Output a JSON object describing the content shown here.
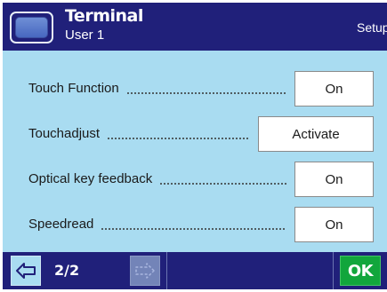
{
  "header": {
    "title": "Terminal",
    "user": "User 1",
    "setup": "Setup",
    "icon": "terminal-icon"
  },
  "rows": [
    {
      "label": "Touch Function",
      "value": "On"
    },
    {
      "label": "Touchadjust",
      "value": "Activate"
    },
    {
      "label": "Optical key feedback",
      "value": "On"
    },
    {
      "label": "Speedread",
      "value": "On"
    }
  ],
  "footer": {
    "page": "2/2",
    "back_icon": "arrow-left-icon",
    "forward_icon": "arrow-right-disabled-icon",
    "ok_label": "OK"
  },
  "colors": {
    "background": "#a9dcf1",
    "bar": "#20207a",
    "ok": "#12a63c"
  }
}
